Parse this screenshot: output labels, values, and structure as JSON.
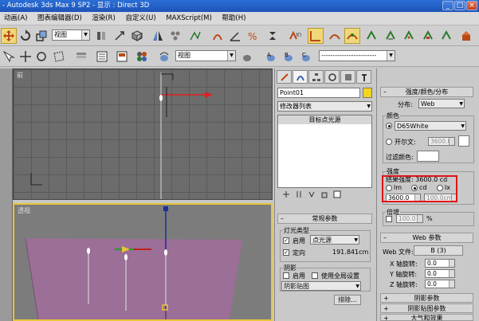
{
  "window": {
    "title": "- Autodesk 3ds Max 9 SP2  - 显示 : Direct 3D",
    "minimize": "_",
    "maximize": "□",
    "close": "×"
  },
  "menubar": {
    "items": [
      "动画(A)",
      "图表编辑器(D)",
      "渲染(R)",
      "自定义(U)",
      "MAXScript(M)",
      "帮助(H)"
    ]
  },
  "toolbar1": {
    "view_select": "视图"
  },
  "toolbar2": {
    "view_select": "视图",
    "named_selection": "------------------------"
  },
  "viewports": {
    "top_label": "前",
    "persp_label": "透视"
  },
  "command_panel": {
    "object_name": "Point01",
    "object_color": "#f5d321",
    "modifier_list": "修改器列表",
    "stack_item": "目标点光源",
    "general_rollout": "常规参数",
    "light_type_group": "灯光类型",
    "enable_label": "启用",
    "light_type": "点光源",
    "target_label": "定向",
    "target_distance": "191.841cm",
    "shadow_group": "阴影",
    "shadow_enable": "启用",
    "use_global": "使用全局设置",
    "shadow_type": "阴影贴图",
    "exclude_button": "排除..."
  },
  "intensity_panel": {
    "rollout_title": "强度/颜色/分布",
    "distribution_label": "分布:",
    "distribution_value": "Web",
    "color_group": "颜色",
    "preset_color": "D65White",
    "kelvin_label": "开尔文:",
    "kelvin_value": "3600.0",
    "filter_color_label": "过滤颜色:",
    "intensity_group": "强度",
    "result_intensity": "结果强度: 3600.0 cd",
    "unit_lm": "lm",
    "unit_cd": "cd",
    "unit_lx": "lx",
    "intensity_value": "3600.0",
    "distance_value": "100.0cm",
    "multiplier_group": "倍增",
    "multiplier_value": "100.0",
    "multiplier_unit": "%",
    "web_rollout": "Web 参数",
    "web_file_label": "Web 文件:",
    "web_file_value": "B (3)",
    "x_rot_label": "X 轴旋转:",
    "x_rot": "0.0",
    "y_rot_label": "Y 轴旋转:",
    "y_rot": "0.0",
    "z_rot_label": "Z 轴旋转:",
    "z_rot": "0.0",
    "shadow_params": "阴影参数",
    "shadow_map_params": "阴影贴图参数",
    "atmos_params": "大气和效果"
  },
  "colors": {
    "title_bar": "#1c54b8",
    "highlight_box": "#e01515",
    "viewport_active_border": "#e8c53a",
    "plane_color": "#9b6f97"
  }
}
